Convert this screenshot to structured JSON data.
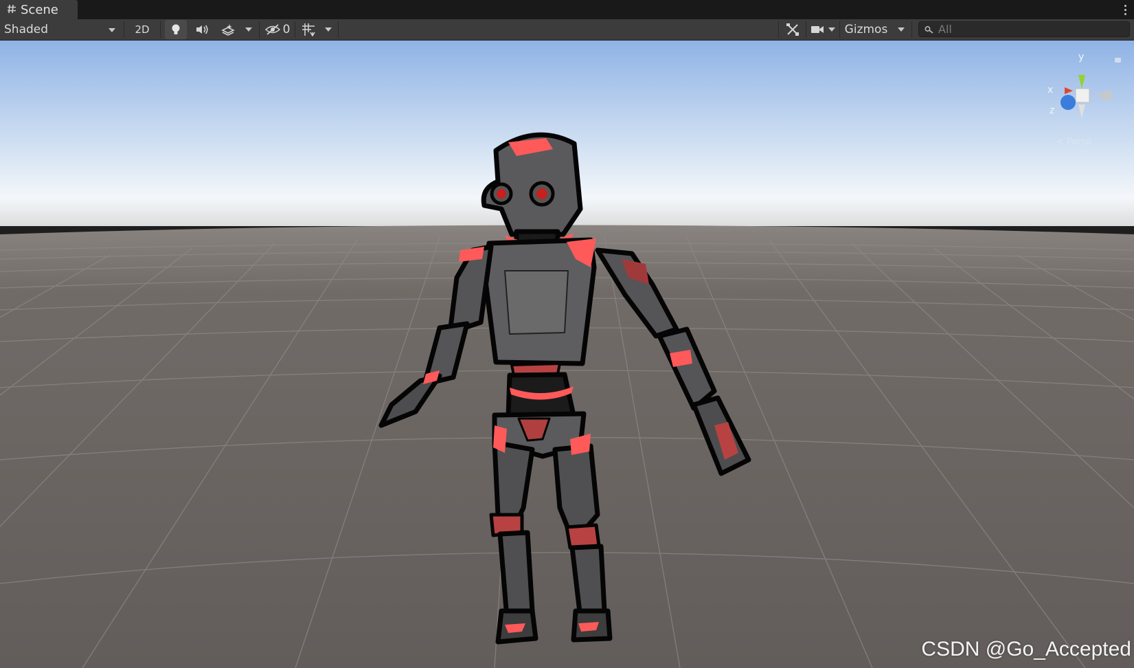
{
  "tab": {
    "title": "Scene",
    "icon": "scene-grid-icon",
    "menu_icon": "more-vertical-icon"
  },
  "toolbar": {
    "draw_mode": "Shaded",
    "mode_2d": "2D",
    "lighting_icon": "light-bulb-icon",
    "audio_icon": "speaker-icon",
    "effects_icon": "effects-layers-icon",
    "hidden_count": "0",
    "hidden_icon": "eye-hidden-icon",
    "grid_icon": "grid-snap-icon",
    "tools_icon": "tools-icon",
    "camera_icon": "camera-icon",
    "gizmos_label": "Gizmos",
    "search_placeholder": "All",
    "search_value": ""
  },
  "orientation_gizmo": {
    "axis_y": "y",
    "axis_x": "x",
    "axis_z": "z",
    "projection_label": "Persp",
    "lock_icon": "lock-icon",
    "axis_colors": {
      "x": "#e2452f",
      "y": "#94d22e",
      "z": "#3a7ddd"
    }
  },
  "watermark": "CSDN @Go_Accepted",
  "colors": {
    "sky_top": "#8fb3e5",
    "horizon": "#f6f8fa",
    "ground": "#6b6562",
    "grid_line": "#8b8784",
    "robot_body": "#5c5c5e",
    "robot_accent": "#ff5a5a",
    "robot_outline": "#050505"
  }
}
